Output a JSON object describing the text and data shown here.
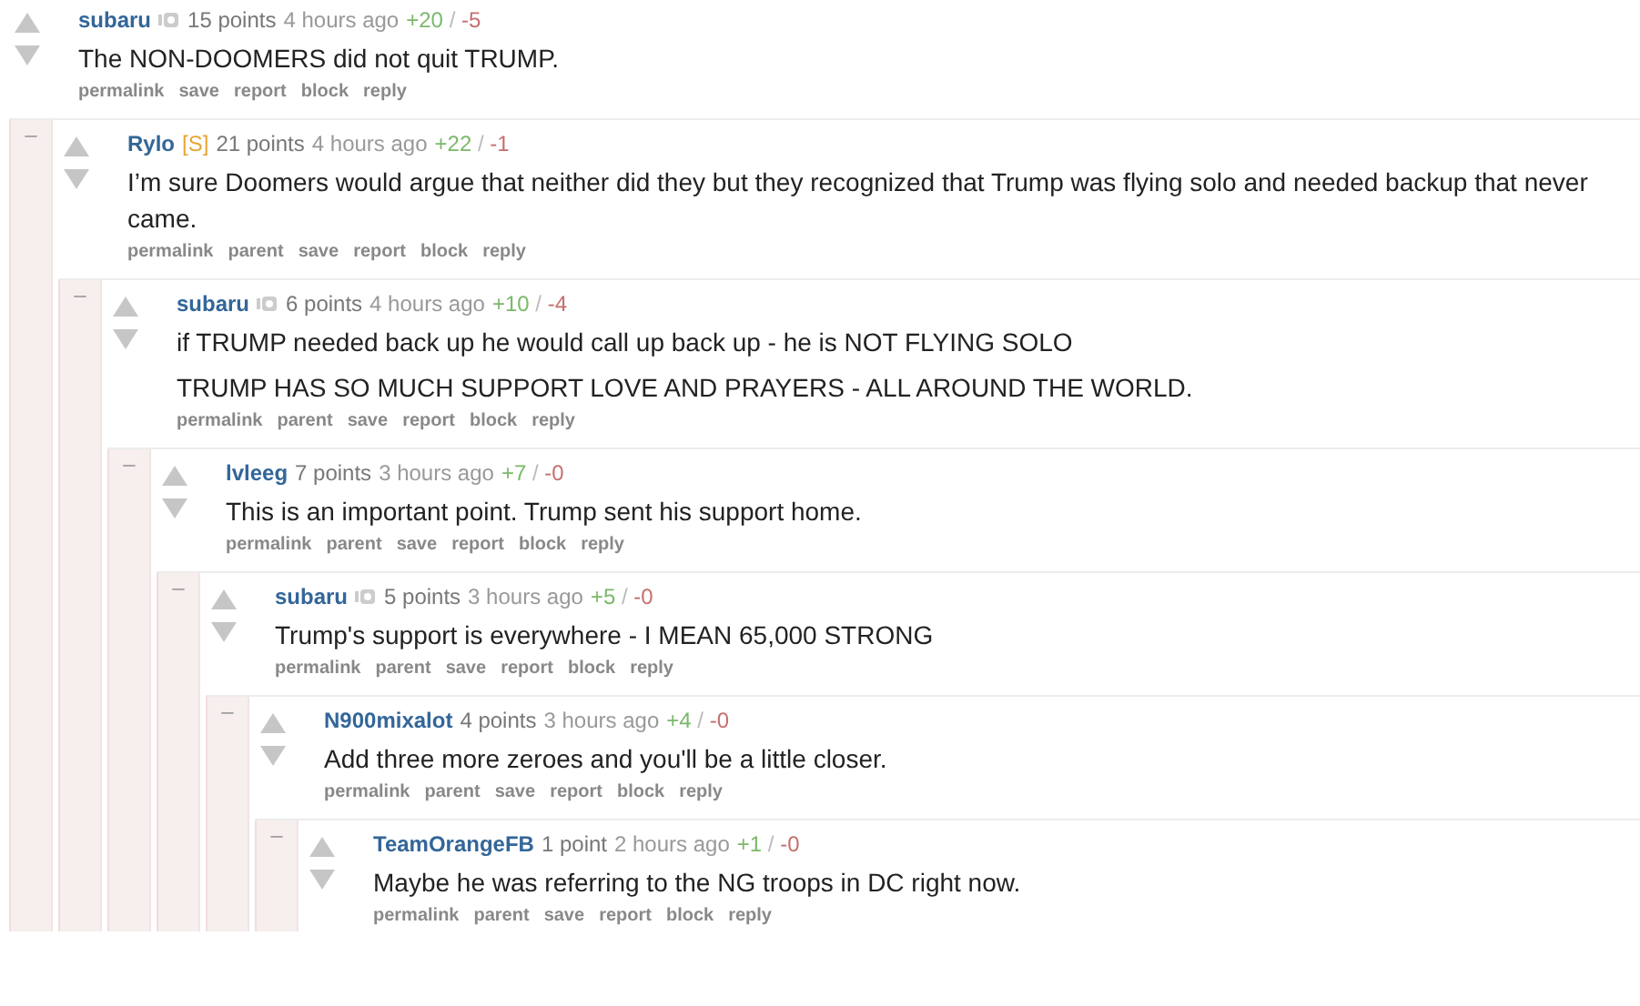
{
  "comments": [
    {
      "author": "subaru",
      "badge_icon": true,
      "points": "15 points",
      "time": "4 hours ago",
      "up": "+20",
      "separator": "/",
      "down": "-5",
      "body": [
        "The NON-DOOMERS did not quit TRUMP."
      ],
      "actions": [
        "permalink",
        "save",
        "report",
        "block",
        "reply"
      ],
      "children": [
        {
          "collapse": "–",
          "author": "Rylo",
          "flair": "[S]",
          "badge_icon": false,
          "points": "21 points",
          "time": "4 hours ago",
          "up": "+22",
          "separator": "/",
          "down": "-1",
          "body": [
            "I’m sure Doomers would argue that neither did they but they recognized that Trump was flying solo and needed backup that never came."
          ],
          "actions": [
            "permalink",
            "parent",
            "save",
            "report",
            "block",
            "reply"
          ],
          "children": [
            {
              "collapse": "–",
              "author": "subaru",
              "badge_icon": true,
              "points": "6 points",
              "time": "4 hours ago",
              "up": "+10",
              "separator": "/",
              "down": "-4",
              "body": [
                "if TRUMP needed back up he would call up back up - he is NOT FLYING SOLO",
                "TRUMP HAS SO MUCH SUPPORT LOVE AND PRAYERS - ALL AROUND THE WORLD."
              ],
              "actions": [
                "permalink",
                "parent",
                "save",
                "report",
                "block",
                "reply"
              ],
              "children": [
                {
                  "collapse": "–",
                  "author": "lvleeg",
                  "badge_icon": false,
                  "points": "7 points",
                  "time": "3 hours ago",
                  "up": "+7",
                  "separator": "/",
                  "down": "-0",
                  "body": [
                    "This is an important point. Trump sent his support home."
                  ],
                  "actions": [
                    "permalink",
                    "parent",
                    "save",
                    "report",
                    "block",
                    "reply"
                  ],
                  "children": [
                    {
                      "collapse": "–",
                      "author": "subaru",
                      "badge_icon": true,
                      "points": "5 points",
                      "time": "3 hours ago",
                      "up": "+5",
                      "separator": "/",
                      "down": "-0",
                      "body": [
                        "Trump's support is everywhere - I MEAN 65,000 STRONG"
                      ],
                      "actions": [
                        "permalink",
                        "parent",
                        "save",
                        "report",
                        "block",
                        "reply"
                      ],
                      "children": [
                        {
                          "collapse": "–",
                          "author": "N900mixalot",
                          "badge_icon": false,
                          "points": "4 points",
                          "time": "3 hours ago",
                          "up": "+4",
                          "separator": "/",
                          "down": "-0",
                          "body": [
                            "Add three more zeroes and you'll be a little closer."
                          ],
                          "actions": [
                            "permalink",
                            "parent",
                            "save",
                            "report",
                            "block",
                            "reply"
                          ],
                          "children": [
                            {
                              "collapse": "–",
                              "author": "TeamOrangeFB",
                              "badge_icon": false,
                              "points": "1 point",
                              "time": "2 hours ago",
                              "up": "+1",
                              "separator": "/",
                              "down": "-0",
                              "body": [
                                "Maybe he was referring to the NG troops in DC right now."
                              ],
                              "actions": [
                                "permalink",
                                "parent",
                                "save",
                                "report",
                                "block",
                                "reply"
                              ]
                            }
                          ]
                        }
                      ]
                    }
                  ]
                }
              ]
            }
          ]
        }
      ]
    }
  ]
}
